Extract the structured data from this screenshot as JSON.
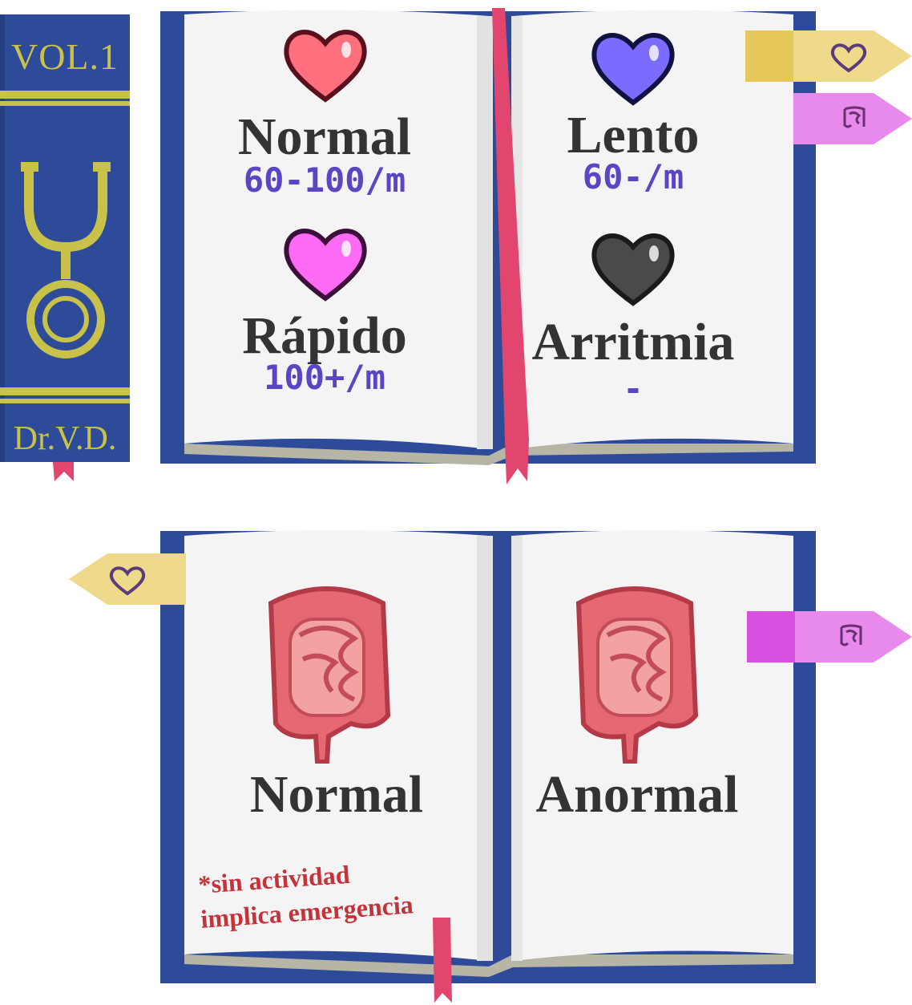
{
  "spine": {
    "volume": "VOL.1",
    "author": "Dr.V.D.",
    "emblem": "stethoscope-icon"
  },
  "book1": {
    "left_top": {
      "icon": "heart-icon",
      "color": "#ff6f7d",
      "label": "Normal",
      "rate": "60-100/m"
    },
    "left_bottom": {
      "icon": "heart-icon",
      "color": "#ff6bf4",
      "label": "Rápido",
      "rate": "100+/m"
    },
    "right_top": {
      "icon": "heart-icon",
      "color": "#7b6cff",
      "label": "Lento",
      "rate": "60-/m"
    },
    "right_bottom": {
      "icon": "heart-icon",
      "color": "#4a4a4a",
      "label": "Arritmia",
      "rate": "-"
    },
    "tabs": [
      {
        "icon": "heart-outline-icon",
        "color": "#efd98a"
      },
      {
        "icon": "intestine-icon",
        "color": "#e889ec"
      }
    ]
  },
  "book2": {
    "left": {
      "icon": "intestine-icon",
      "label": "Normal"
    },
    "right": {
      "icon": "intestine-icon",
      "label": "Anormal"
    },
    "note_line1": "*sin actividad",
    "note_line2": "implica emergencia",
    "tabs": [
      {
        "icon": "heart-outline-icon",
        "color": "#efd98a"
      },
      {
        "icon": "intestine-icon",
        "color": "#e06ae6"
      }
    ]
  },
  "colors": {
    "cover": "#2e4b9a",
    "page": "#f4f4f4",
    "page_edge": "#b7b5a6",
    "ribbon": "#e2456d",
    "gold": "#c9c24a"
  }
}
